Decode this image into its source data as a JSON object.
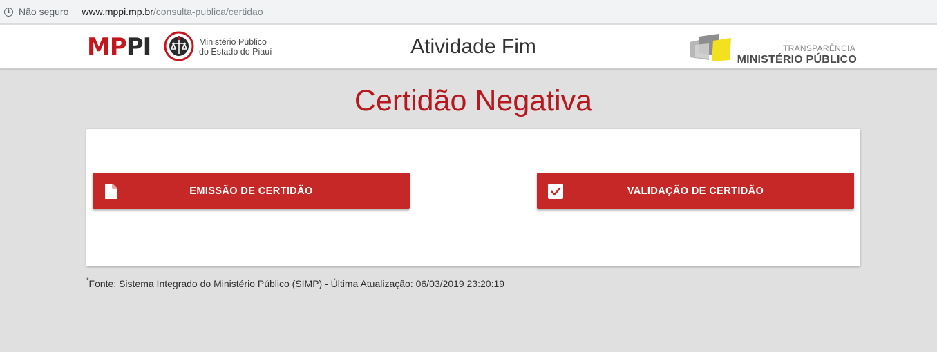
{
  "browser": {
    "security_label": "Não seguro",
    "url_host": "www.mppi.mp.br",
    "url_path": "/consulta-publica/certidao"
  },
  "header": {
    "logo_text_mp": "MP",
    "logo_text_pi": "PI",
    "logo_subtitle_line1": "Ministério Público",
    "logo_subtitle_line2": "do Estado do Piauí",
    "title": "Atividade Fim",
    "transparency_small": "TRANSPARÊNCIA",
    "transparency_big": "MINISTÉRIO PÚBLICO"
  },
  "main": {
    "page_title": "Certidão Negativa",
    "buttons": {
      "emissao_label": "EMISSÃO DE CERTIDÃO",
      "validacao_label": "VALIDAÇÃO DE CERTIDÃO"
    },
    "footnote_marker": "*",
    "footnote_text": "Fonte: Sistema Integrado do Ministério Público (SIMP) - Última Atualização: 06/03/2019 23:20:19"
  },
  "colors": {
    "brand_red": "#c62828",
    "title_red": "#b5191f",
    "background": "#e0e0e0"
  },
  "icons": {
    "security": "info-icon",
    "emissao": "document-icon",
    "validacao": "checkbox-checked-icon"
  }
}
